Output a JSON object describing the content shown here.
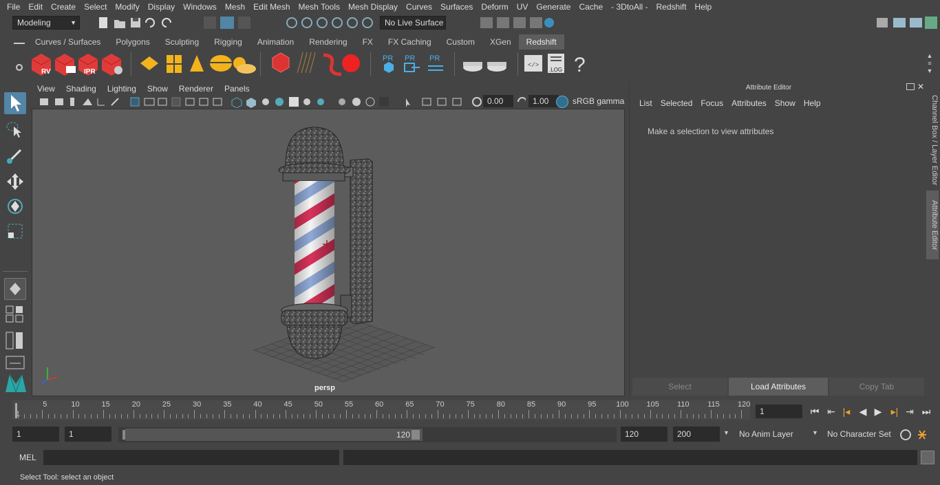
{
  "menubar": [
    "File",
    "Edit",
    "Create",
    "Select",
    "Modify",
    "Display",
    "Windows",
    "Mesh",
    "Edit Mesh",
    "Mesh Tools",
    "Mesh Display",
    "Curves",
    "Surfaces",
    "Deform",
    "UV",
    "Generate",
    "Cache",
    "- 3DtoAll -",
    "Redshift",
    "Help"
  ],
  "statusline": {
    "mode": "Modeling",
    "live_surface": "No Live Surface"
  },
  "shelf_tabs": [
    "Curves / Surfaces",
    "Polygons",
    "Sculpting",
    "Rigging",
    "Animation",
    "Rendering",
    "FX",
    "FX Caching",
    "Custom",
    "XGen",
    "Redshift"
  ],
  "shelf_active": "Redshift",
  "shelf_labels": {
    "rv": "RV",
    "ipr": "IPR",
    "pr": "PR",
    "log": ".LOG",
    "help": "?"
  },
  "viewport": {
    "menus": [
      "View",
      "Shading",
      "Lighting",
      "Show",
      "Renderer",
      "Panels"
    ],
    "exposure": "0.00",
    "gamma": "1.00",
    "colorspace": "sRGB gamma",
    "camera": "persp"
  },
  "attribute_editor": {
    "title": "Attribute Editor",
    "menus": [
      "List",
      "Selected",
      "Focus",
      "Attributes",
      "Show",
      "Help"
    ],
    "message": "Make a selection to view attributes",
    "buttons": [
      "Select",
      "Load Attributes",
      "Copy Tab"
    ]
  },
  "side_tabs": [
    "Channel Box / Layer Editor",
    "Attribute Editor"
  ],
  "timeline": {
    "ticks": [
      5,
      10,
      15,
      20,
      25,
      30,
      35,
      40,
      45,
      50,
      55,
      60,
      65,
      70,
      75,
      80,
      85,
      90,
      95,
      100,
      105,
      110,
      115,
      120
    ],
    "first": "1",
    "current_frame": "1"
  },
  "range": {
    "start": "1",
    "playback_start": "1",
    "slider_start": "1",
    "slider_end": "120",
    "playback_end": "120",
    "end": "200",
    "anim_layer": "No Anim Layer",
    "character_set": "No Character Set"
  },
  "command": {
    "label": "MEL"
  },
  "help_line": "Select Tool: select an object",
  "colors": {
    "accent": "#5285a6",
    "stripe_red": "#d8335a",
    "stripe_blue": "#8fa9d6",
    "render_red": "#e03b3b"
  }
}
